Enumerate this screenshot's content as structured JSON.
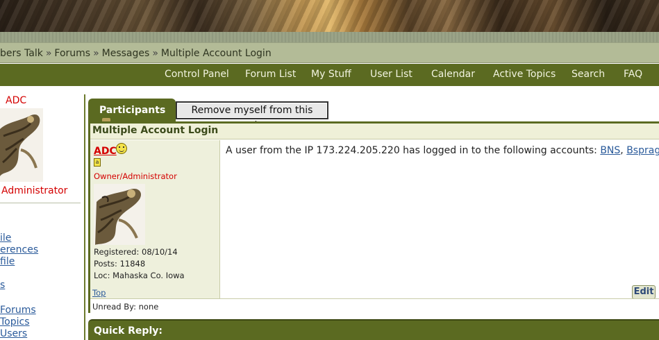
{
  "breadcrumb": {
    "items": [
      "bers Talk",
      "Forums",
      "Messages",
      "Multiple Account Login"
    ],
    "separator": "»"
  },
  "nav": {
    "items": [
      "Control Panel",
      "Forum List",
      "My Stuff",
      "User List",
      "Calendar",
      "Active Topics",
      "Search",
      "FAQ"
    ]
  },
  "sidebar": {
    "username": "ADC",
    "role": "Administrator",
    "links": [
      "ile",
      "erences",
      "file",
      "s",
      " Forums",
      " Topics",
      " Users"
    ]
  },
  "topic": {
    "participants_tab": "Participants",
    "remove_button": "Remove myself from this topic.",
    "title": "Multiple Account Login"
  },
  "post": {
    "author": "ADC",
    "rank": "Owner/Administrator",
    "registered": "Registered: 08/10/14",
    "posts": "Posts: 11848",
    "location": "Loc: Mahaska Co. Iowa",
    "top_link": "Top",
    "message_prefix": "A user from the IP 173.224.205.220 has logged in to the following accounts:",
    "accounts": [
      "BNS",
      "Bsprague"
    ],
    "account_separator": ",",
    "edit_button": "Edit",
    "unread_by": "Unread By: none"
  },
  "quick_reply": {
    "title": "Quick Reply:"
  },
  "colors": {
    "nav_bg": "#5b6a21",
    "breadcrumb_bg": "#b3bb97",
    "username_red": "#d40000",
    "link_blue": "#2a5a9a",
    "post_sidebar_bg": "#eef0dc"
  },
  "icons": {
    "smiley": "smiley-icon",
    "badge": "member-badge-icon",
    "dropdown": "dropdown-caret-icon"
  }
}
